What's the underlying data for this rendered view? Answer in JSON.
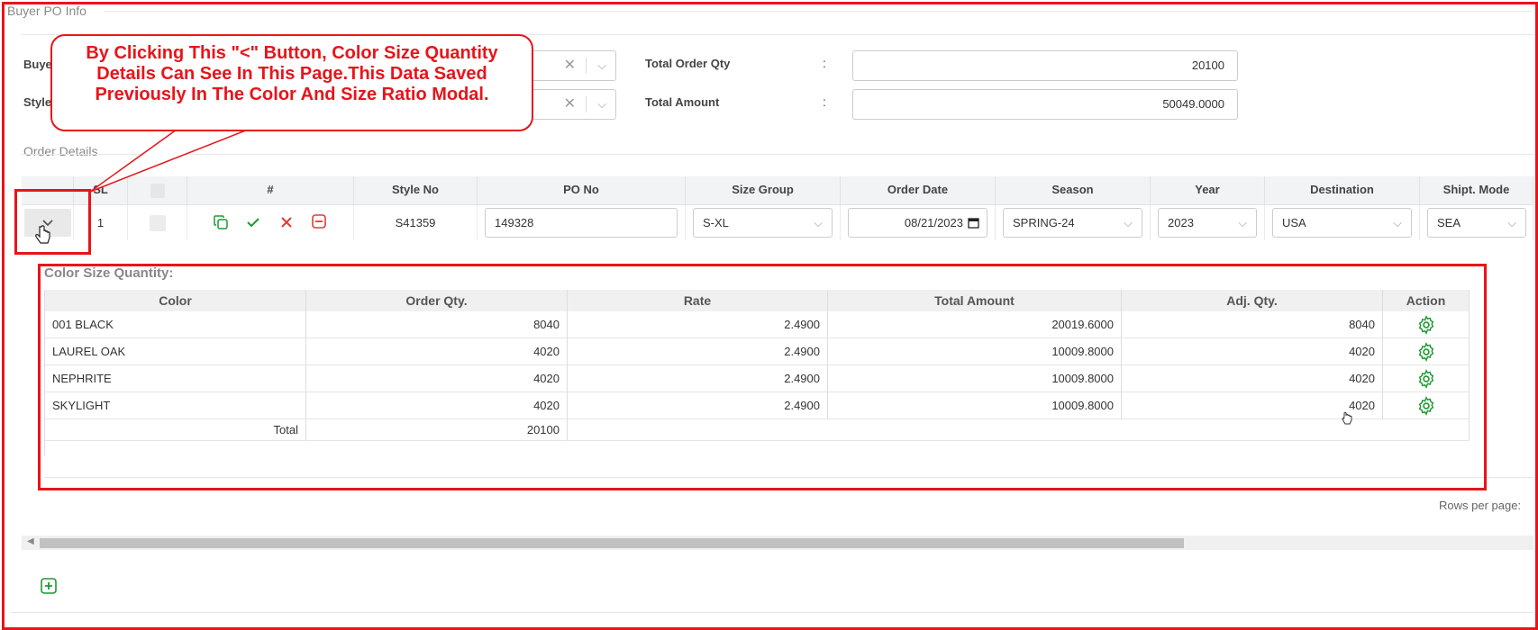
{
  "section_title": "Buyer PO Info",
  "form": {
    "buyer_label": "Buye",
    "style_label": "Style",
    "total_order_qty_label": "Total Order Qty",
    "total_order_qty_value": "20100",
    "total_amount_label": "Total Amount",
    "total_amount_value": "50049.0000",
    "colon": ":"
  },
  "callout": {
    "line1": "By Clicking This \"<\" Button, Color Size Quantity",
    "line2": "Details Can See In This Page.This Data Saved",
    "line3": "Previously In The Color And Size Ratio Modal."
  },
  "order_details": {
    "title": "Order Details",
    "headers": {
      "sl": "SL",
      "hash": "#",
      "style_no": "Style No",
      "po_no": "PO No",
      "size_group": "Size Group",
      "order_date": "Order Date",
      "season": "Season",
      "year": "Year",
      "destination": "Destination",
      "shipt_mode": "Shipt. Mode"
    },
    "row": {
      "sl": "1",
      "style_no": "S41359",
      "po_no": "149328",
      "size_group": "S-XL",
      "order_date": "08/21/2023",
      "season": "SPRING-24",
      "year": "2023",
      "destination": "USA",
      "shipt_mode": "SEA"
    }
  },
  "color_size": {
    "title": "Color Size Quantity:",
    "headers": [
      "Color",
      "Order Qty.",
      "Rate",
      "Total Amount",
      "Adj. Qty.",
      "Action"
    ],
    "rows": [
      {
        "color": "001 BLACK",
        "order_qty": "8040",
        "rate": "2.4900",
        "total_amount": "20019.6000",
        "adj_qty": "8040"
      },
      {
        "color": "LAUREL OAK",
        "order_qty": "4020",
        "rate": "2.4900",
        "total_amount": "10009.8000",
        "adj_qty": "4020"
      },
      {
        "color": "NEPHRITE",
        "order_qty": "4020",
        "rate": "2.4900",
        "total_amount": "10009.8000",
        "adj_qty": "4020"
      },
      {
        "color": "SKYLIGHT",
        "order_qty": "4020",
        "rate": "2.4900",
        "total_amount": "10009.8000",
        "adj_qty": "4020"
      }
    ],
    "total_label": "Total",
    "total_value": "20100"
  },
  "pagination": {
    "rows_per_page_label": "Rows per page:"
  },
  "icons": {
    "copy": "copy-icon",
    "check": "check-icon",
    "cancel": "close-icon",
    "remove": "minus-square-icon",
    "expand": "chevron-down-icon",
    "gear": "gear-icon",
    "add": "plus-square-icon"
  },
  "colors": {
    "annotation_red": "#e8141a",
    "action_green": "#1e9a32",
    "cancel_red": "#e53935"
  }
}
